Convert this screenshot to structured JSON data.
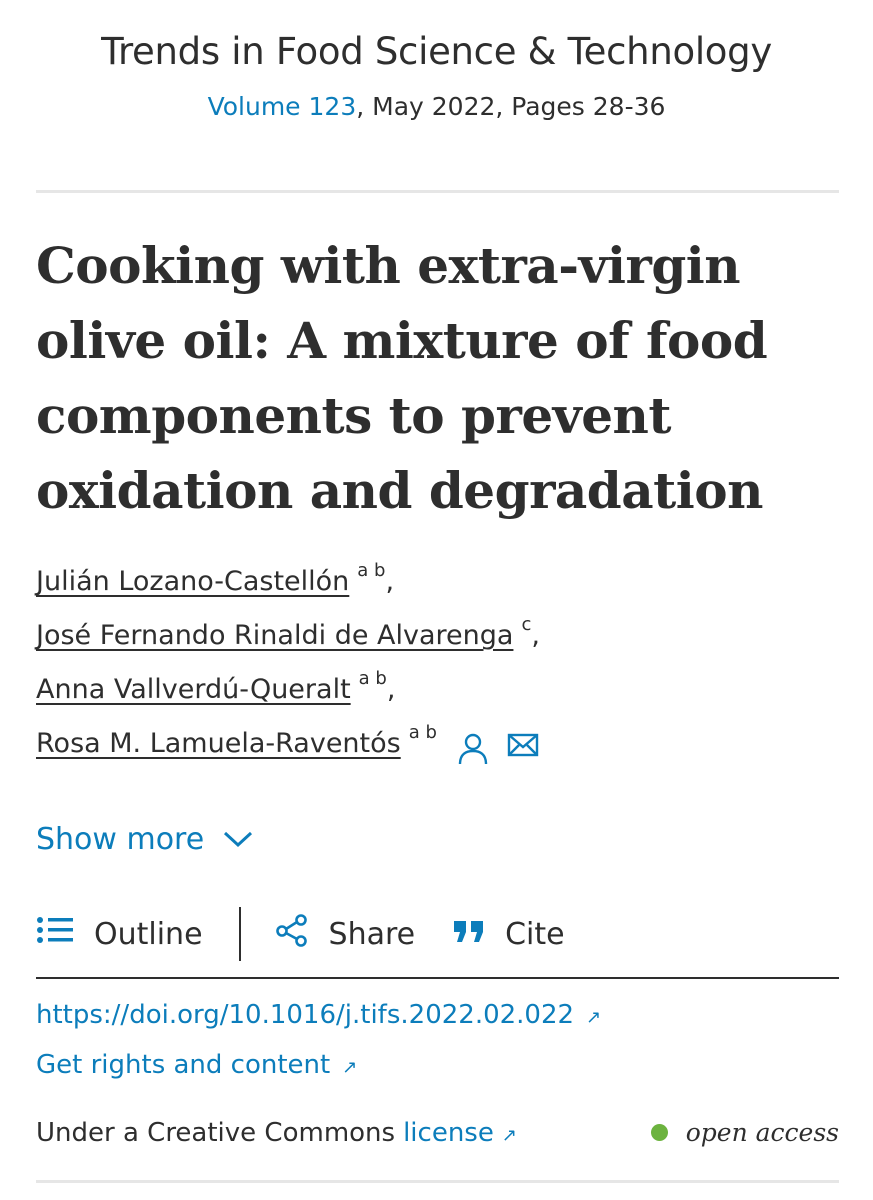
{
  "journal": {
    "name": "Trends in Food Science & Technology",
    "volume_link": "Volume 123",
    "issue_rest": ", May 2022, Pages 28-36"
  },
  "article": {
    "title": "Cooking with extra-virgin olive oil: A mixture of food components to prevent oxidation and degradation"
  },
  "authors": [
    {
      "name": "Julián Lozano-Castellón",
      "affiliations": "a b",
      "suffix": ","
    },
    {
      "name": "José Fernando Rinaldi de Alvarenga",
      "affiliations": "c",
      "suffix": ","
    },
    {
      "name": "Anna Vallverdú-Queralt",
      "affiliations": "a b",
      "suffix": ","
    },
    {
      "name": "Rosa M. Lamuela-Raventós",
      "affiliations": "a b",
      "suffix": "",
      "icons": [
        "person-icon",
        "mail-icon"
      ]
    }
  ],
  "show_more": {
    "label": "Show more",
    "icon": "chevron-down-icon"
  },
  "toolbar": {
    "outline": {
      "label": "Outline",
      "icon": "list-icon"
    },
    "share": {
      "label": "Share",
      "icon": "share-icon"
    },
    "cite": {
      "label": "Cite",
      "icon": "quote-icon"
    }
  },
  "links": {
    "doi": "https://doi.org/10.1016/j.tifs.2022.02.022",
    "rights": "Get rights and content",
    "external_icon": "↗"
  },
  "license": {
    "prefix": "Under a Creative Commons",
    "link": "license",
    "open_access": "open access"
  },
  "colors": {
    "link": "#0c7dbb",
    "text": "#2e2e2e",
    "open_access_dot": "#6cb33f",
    "rule_light": "#e6e6e6"
  }
}
